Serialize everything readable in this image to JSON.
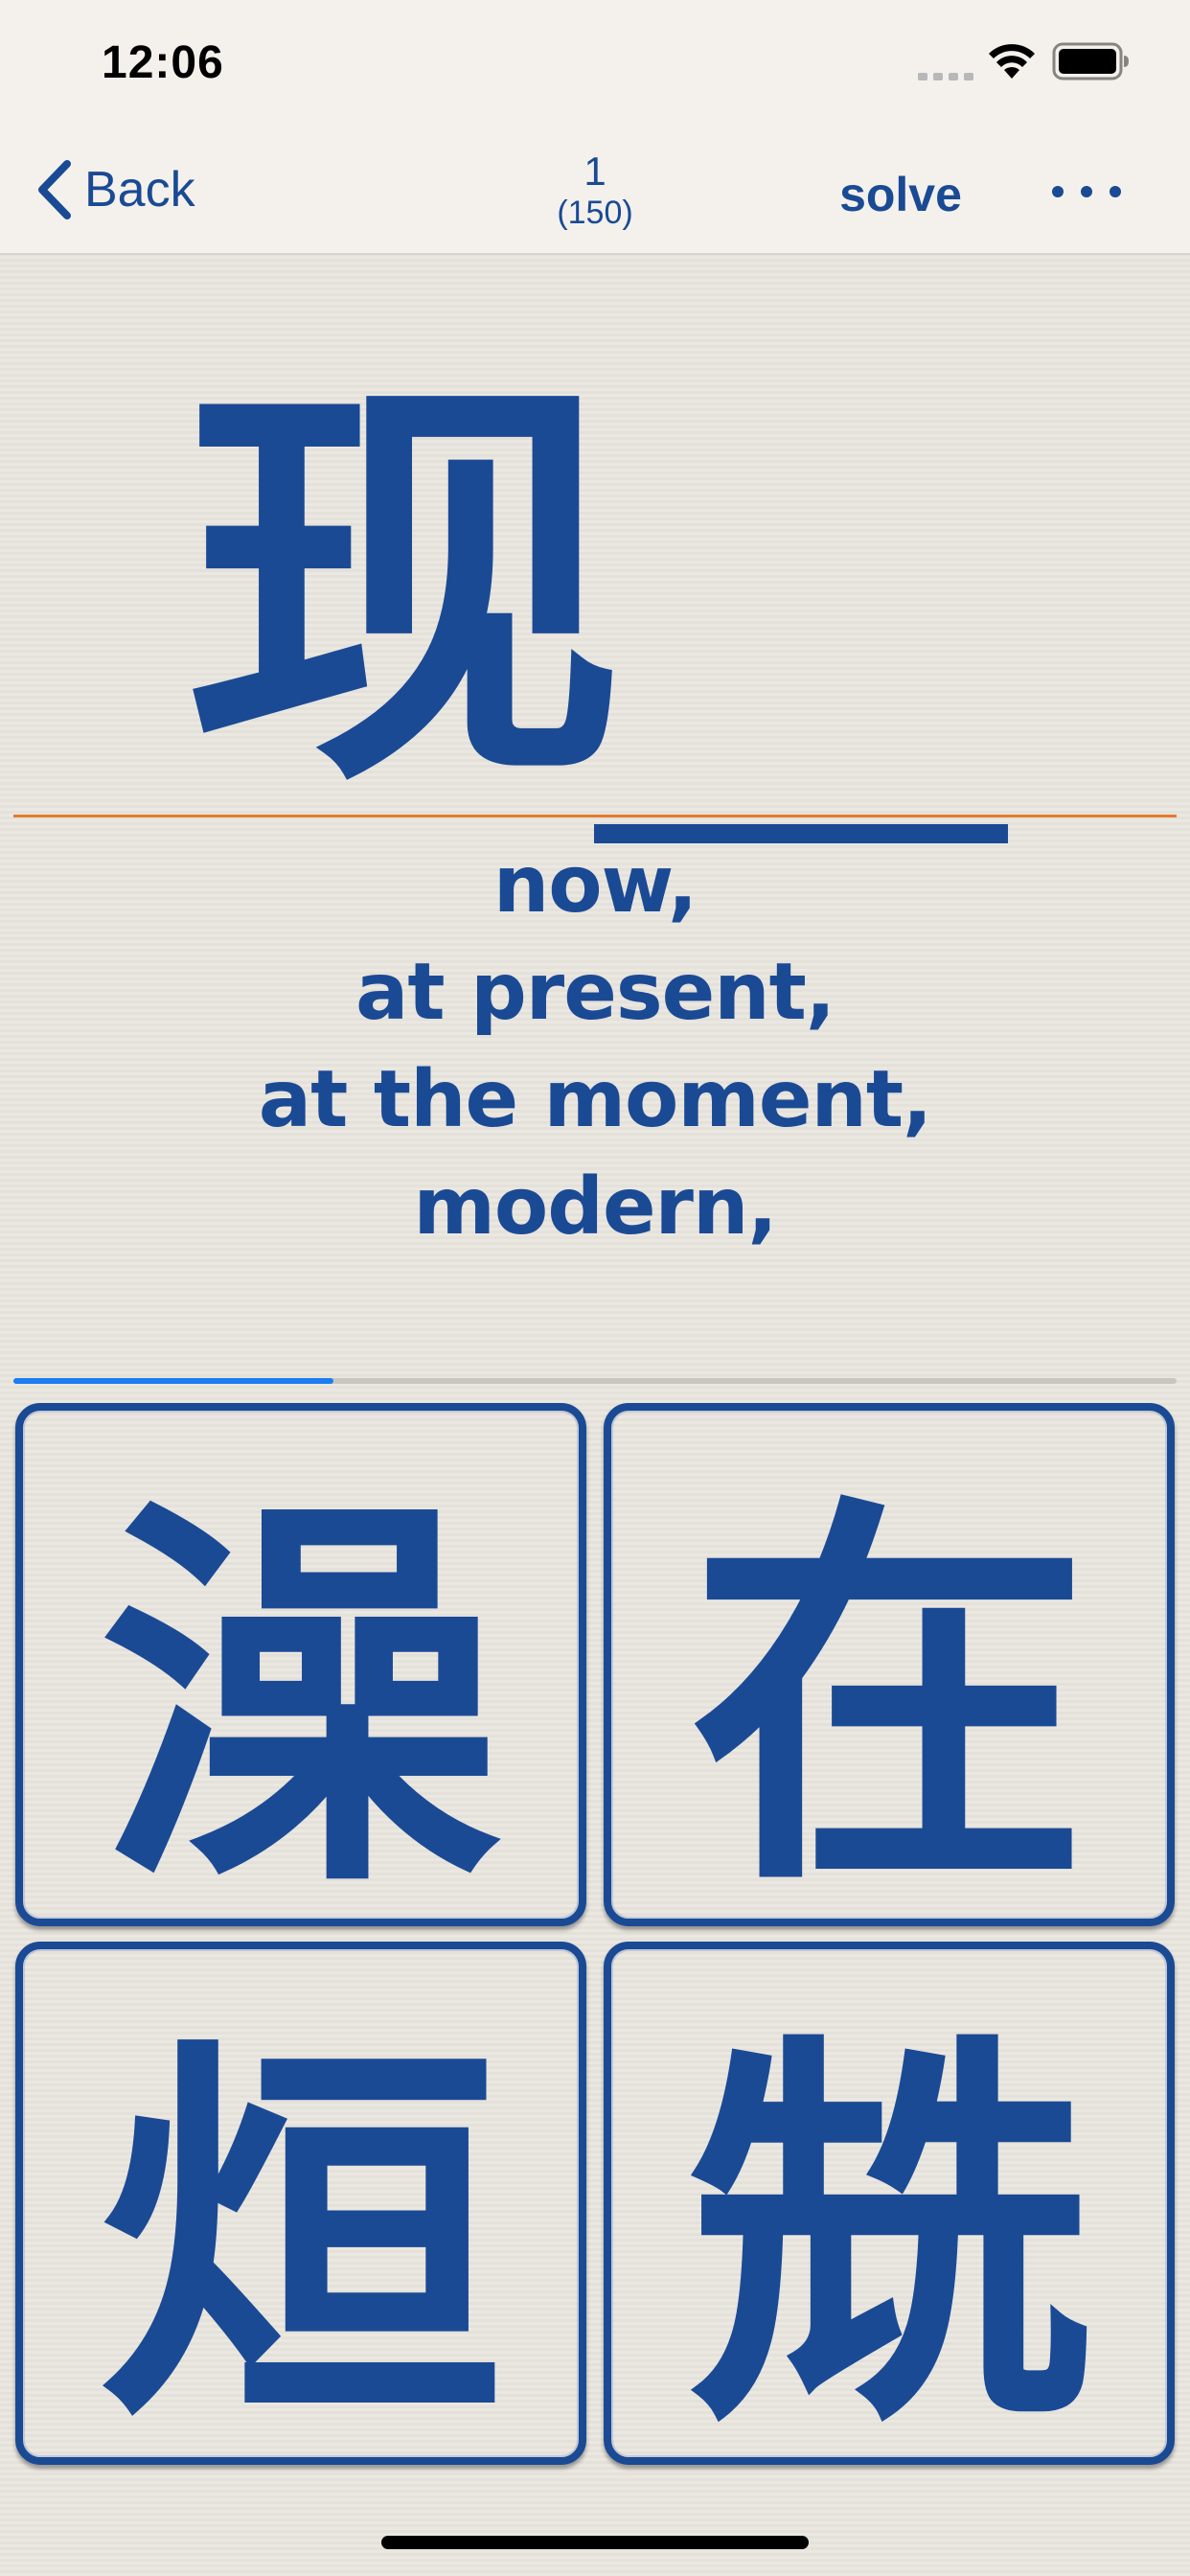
{
  "status_bar": {
    "time": "12:06",
    "signal_icon": "cellular-signal-icon",
    "wifi_icon": "wifi-icon",
    "battery_icon": "battery-icon"
  },
  "nav": {
    "back_label": "Back",
    "counter_current": "1",
    "counter_total": "(150)",
    "solve_label": "solve",
    "more_icon": "ellipsis-icon"
  },
  "question": {
    "character": "现",
    "meanings": [
      "now,",
      "at present,",
      "at the moment,",
      "modern,"
    ]
  },
  "progress": {
    "fraction": 0.275
  },
  "options": [
    {
      "character": "澡"
    },
    {
      "character": "在"
    },
    {
      "character": "烜"
    },
    {
      "character": "兟"
    }
  ],
  "colors": {
    "accent": "#1a4a94",
    "divider": "#e47a2c",
    "progress": "#1c7cf0",
    "background": "#ebe7e1"
  }
}
